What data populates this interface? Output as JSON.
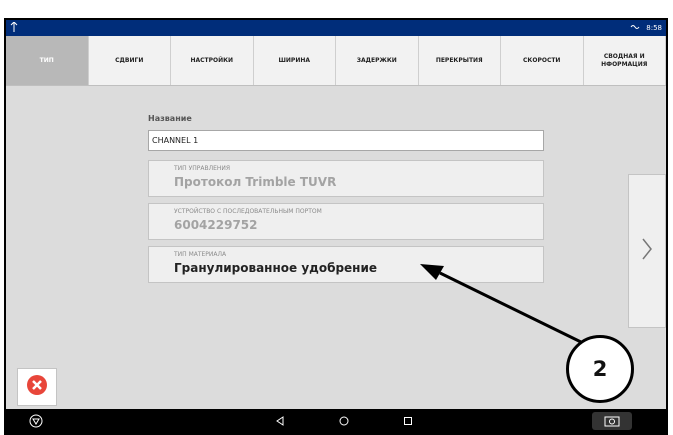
{
  "statusbar": {
    "left_icon": "gps-icon",
    "signal_icon": "signal-icon",
    "time": "8:58"
  },
  "tabs": [
    {
      "label": "ТИП",
      "active": true
    },
    {
      "label": "СДВИГИ",
      "active": false
    },
    {
      "label": "НАСТРОЙКИ",
      "active": false
    },
    {
      "label": "ШИРИНА",
      "active": false
    },
    {
      "label": "ЗАДЕРЖКИ",
      "active": false
    },
    {
      "label": "ПЕРЕКРЫТИЯ",
      "active": false
    },
    {
      "label": "СКОРОСТИ",
      "active": false
    },
    {
      "label": "СВОДНАЯ И НФОРМАЦИЯ",
      "active": false
    }
  ],
  "form": {
    "name_label": "Название",
    "name_value": "CHANNEL 1",
    "control_type_label": "ТИП УПРАВЛЕНИЯ",
    "control_type_value": "Протокол Trimble TUVR",
    "serial_label": "УСТРОЙСТВО С ПОСЛЕДОВАТЕЛЬНЫМ ПОРТОМ",
    "serial_value": "6004229752",
    "material_label": "ТИП МАТЕРИАЛА",
    "material_value": "Гранулированное удобрение"
  },
  "navigation": {
    "next_icon": "chevron-right-icon",
    "cancel_icon": "cancel-icon",
    "home_icon": "home-icon",
    "back_icon": "back-icon",
    "circle_icon": "home-circle-icon",
    "recent_icon": "recent-apps-icon",
    "camera_icon": "camera-icon"
  },
  "annotation": {
    "callout_number": "2"
  },
  "colors": {
    "statusbar": "#002d7a",
    "active_tab": "#b8b8b8",
    "cancel": "#e8463a"
  }
}
